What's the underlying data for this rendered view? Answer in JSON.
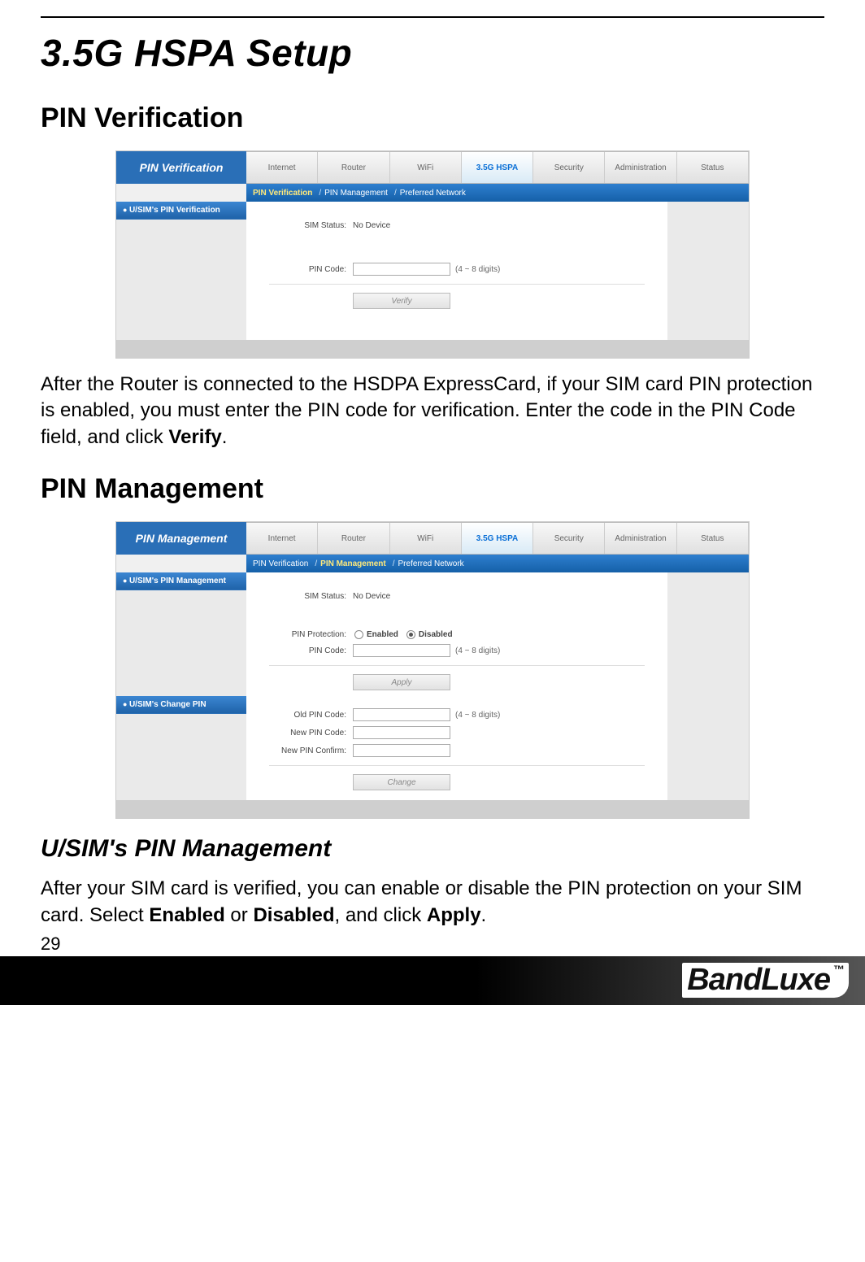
{
  "doc": {
    "title": "3.5G HSPA Setup",
    "section1": "PIN Verification",
    "para1_a": "After the Router is connected to the HSDPA ExpressCard, if your SIM card PIN protection is enabled, you must enter the PIN code for verification. Enter the code in the PIN Code field, and click ",
    "para1_b": "Verify",
    "para1_c": ".",
    "section2": "PIN Management",
    "subsection": "U/SIM's PIN Management",
    "para2_a": "After your SIM card is verified, you can enable or disable the PIN protection on your SIM card. Select ",
    "para2_b": "Enabled",
    "para2_c": " or ",
    "para2_d": "Disabled",
    "para2_e": ", and click ",
    "para2_f": "Apply",
    "para2_g": ".",
    "page_number": "29",
    "brand": "BandLuxe",
    "tm": "™"
  },
  "shot1": {
    "banner": "PIN Verification",
    "tabs": [
      "Internet",
      "Router",
      "WiFi",
      "3.5G HSPA",
      "Security",
      "Administration",
      "Status"
    ],
    "active_tab": "3.5G HSPA",
    "subtabs": [
      "PIN Verification",
      "PIN Management",
      "Preferred Network"
    ],
    "subtab_active": "PIN Verification",
    "side_item": "U/SIM's PIN Verification",
    "sim_status_label": "SIM Status:",
    "sim_status_value": "No Device",
    "pincode_label": "PIN Code:",
    "digits_note": "(4 ~ 8 digits)",
    "verify_btn": "Verify"
  },
  "shot2": {
    "banner": "PIN Management",
    "tabs": [
      "Internet",
      "Router",
      "WiFi",
      "3.5G HSPA",
      "Security",
      "Administration",
      "Status"
    ],
    "active_tab": "3.5G HSPA",
    "subtabs": [
      "PIN Verification",
      "PIN Management",
      "Preferred Network"
    ],
    "subtab_active": "PIN Management",
    "side_item1": "U/SIM's PIN Management",
    "side_item2": "U/SIM's Change PIN",
    "sim_status_label": "SIM Status:",
    "sim_status_value": "No Device",
    "pin_protection_label": "PIN Protection:",
    "opt_enabled": "Enabled",
    "opt_disabled": "Disabled",
    "pincode_label": "PIN Code:",
    "digits_note": "(4 ~ 8 digits)",
    "apply_btn": "Apply",
    "old_pin_label": "Old PIN Code:",
    "new_pin_label": "New PIN Code:",
    "confirm_label": "New PIN Confirm:",
    "change_btn": "Change"
  }
}
